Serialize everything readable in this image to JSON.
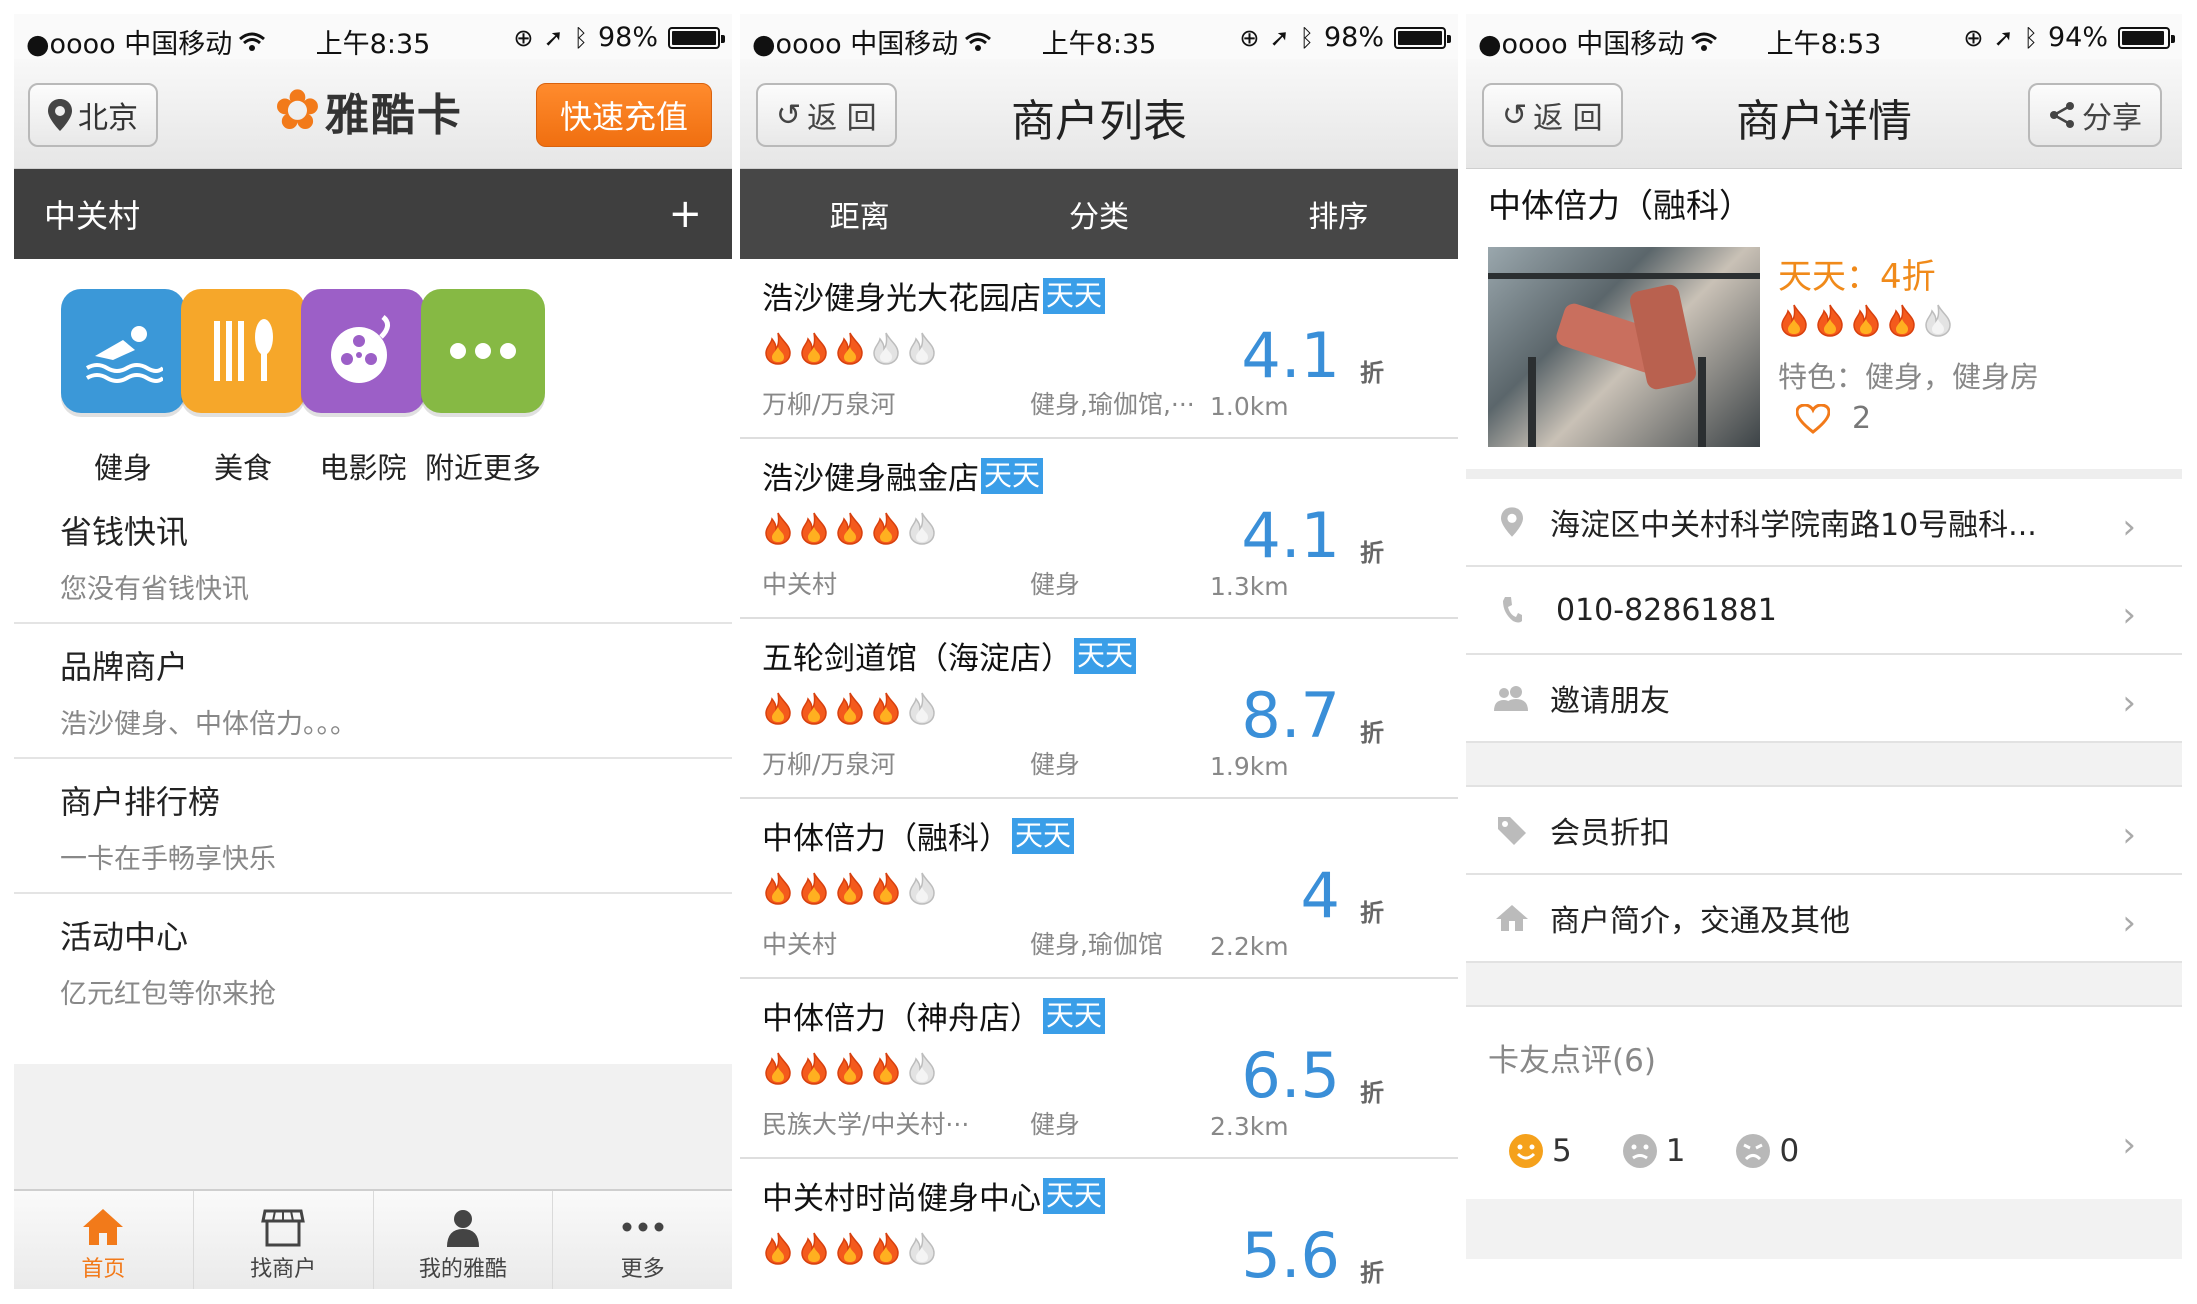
{
  "status": [
    {
      "carrier": "●oooo 中国移动",
      "time": "上午8:35",
      "battery": "98%",
      "battery_level": 0.98
    },
    {
      "carrier": "●oooo 中国移动",
      "time": "上午8:35",
      "battery": "98%",
      "battery_level": 0.98
    },
    {
      "carrier": "●oooo 中国移动",
      "time": "上午8:53",
      "battery": "94%",
      "battery_level": 0.94
    }
  ],
  "home": {
    "city": "北京",
    "logo": "雅酷卡",
    "recharge": "快速充值",
    "area": "中关村",
    "add_symbol": "+",
    "categories": [
      {
        "label": "健身",
        "color": "#3b98d8",
        "icon": "swim-icon"
      },
      {
        "label": "美食",
        "color": "#f6a72a",
        "icon": "food-icon"
      },
      {
        "label": "电影院",
        "color": "#9c5fc7",
        "icon": "film-reel-icon"
      },
      {
        "label": "附近更多",
        "color": "#86b944",
        "icon": "more-icon"
      }
    ],
    "menu": [
      {
        "title": "省钱快讯",
        "sub": "您没有省钱快讯"
      },
      {
        "title": "品牌商户",
        "sub": "浩沙健身、中体倍力。。。"
      },
      {
        "title": "商户排行榜",
        "sub": "一卡在手畅享快乐"
      },
      {
        "title": "活动中心",
        "sub": "亿元红包等你来抢"
      }
    ],
    "tabs": [
      {
        "label": "首页",
        "icon": "home-icon"
      },
      {
        "label": "找商户",
        "icon": "shop-icon"
      },
      {
        "label": "我的雅酷",
        "icon": "user-icon"
      },
      {
        "label": "更多",
        "icon": "more-dots-icon"
      }
    ]
  },
  "list": {
    "back": "返 回",
    "title": "商户列表",
    "filters": [
      "距离",
      "分类",
      "排序"
    ],
    "zhe": "折",
    "merchants": [
      {
        "name": "浩沙健身光大花园店",
        "tag": "天天",
        "rating": 3,
        "discount": "4.1",
        "area": "万柳/万泉河",
        "category": "健身,瑜伽馆,···",
        "distance": "1.0km"
      },
      {
        "name": "浩沙健身融金店",
        "tag": "天天",
        "rating": 4,
        "discount": "4.1",
        "area": "中关村",
        "category": "健身",
        "distance": "1.3km"
      },
      {
        "name": "五轮剑道馆（海淀店）",
        "tag": "天天",
        "rating": 4,
        "discount": "8.7",
        "area": "万柳/万泉河",
        "category": "健身",
        "distance": "1.9km"
      },
      {
        "name": "中体倍力（融科）",
        "tag": "天天",
        "rating": 4,
        "discount": "4",
        "area": "中关村",
        "category": "健身,瑜伽馆",
        "distance": "2.2km"
      },
      {
        "name": "中体倍力（神舟店）",
        "tag": "天天",
        "rating": 4,
        "discount": "6.5",
        "area": "民族大学/中关村···",
        "category": "健身",
        "distance": "2.3km"
      },
      {
        "name": "中关村时尚健身中心",
        "tag": "天天",
        "rating": 4,
        "discount": "5.6",
        "area": "",
        "category": "",
        "distance": ""
      }
    ]
  },
  "detail": {
    "back": "返 回",
    "title": "商户详情",
    "share": "分享",
    "name": "中体倍力（融科）",
    "deal": "天天：4折",
    "rating": 4,
    "feature": "特色：健身，健身房",
    "likes": "2",
    "rows": [
      {
        "text": "海淀区中关村科学院南路10号融科...",
        "icon": "location-pin-icon"
      },
      {
        "text": "010-82861881",
        "icon": "phone-icon"
      },
      {
        "text": "邀请朋友",
        "icon": "friends-icon"
      }
    ],
    "rows2": [
      {
        "text": "会员折扣",
        "icon": "tag-icon"
      },
      {
        "text": "商户简介，交通及其他",
        "icon": "house-icon"
      }
    ],
    "review_title": "卡友点评(6)",
    "reviews": [
      {
        "count": "5",
        "icon": "happy-face-icon",
        "color": "#f5a11c"
      },
      {
        "count": "1",
        "icon": "neutral-face-icon",
        "color": "#b8b8b8"
      },
      {
        "count": "0",
        "icon": "sad-face-icon",
        "color": "#b8b8b8"
      }
    ]
  }
}
